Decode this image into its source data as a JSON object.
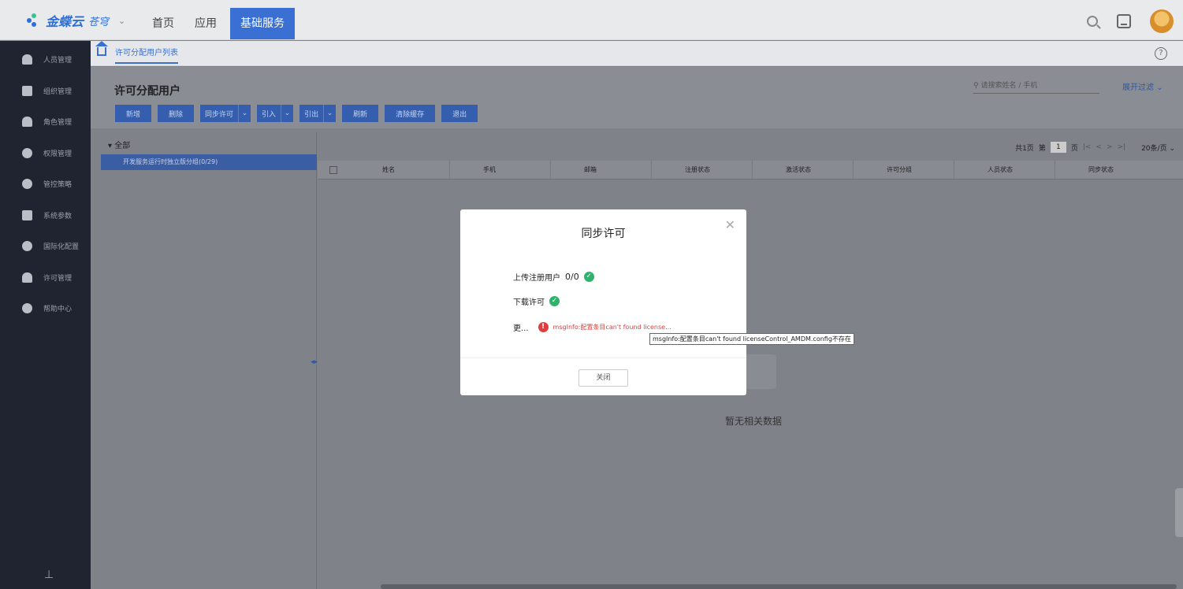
{
  "header": {
    "brand": "金蝶云",
    "brand_sub": "苍穹",
    "nav": [
      "首页",
      "应用",
      "基础服务"
    ]
  },
  "sidebar": {
    "items": [
      {
        "label": "人员管理",
        "icon": "person-icon"
      },
      {
        "label": "组织管理",
        "icon": "org-icon"
      },
      {
        "label": "角色管理",
        "icon": "role-icon"
      },
      {
        "label": "权限管理",
        "icon": "permission-icon"
      },
      {
        "label": "管控策略",
        "icon": "policy-icon"
      },
      {
        "label": "系统参数",
        "icon": "gear-icon"
      },
      {
        "label": "国际化配置",
        "icon": "globe-icon"
      },
      {
        "label": "许可管理",
        "icon": "license-icon"
      },
      {
        "label": "帮助中心",
        "icon": "help-icon"
      }
    ]
  },
  "tab": {
    "label": "许可分配用户列表"
  },
  "page": {
    "title": "许可分配用户",
    "search_placeholder": "请搜索姓名 / 手机",
    "filter_label": "展开过滤",
    "toolbar": {
      "add": "新增",
      "delete": "删除",
      "sync": "同步许可",
      "import": "引入",
      "export": "引出",
      "refresh": "刷新",
      "clear_cache": "清除缓存",
      "exit": "退出"
    }
  },
  "tree": {
    "root": "全部",
    "selected": "开发服务运行时独立版分组(0/29)"
  },
  "grid": {
    "pager": {
      "total": "共1页",
      "prefix": "第",
      "page": "1",
      "suffix": "页",
      "page_size": "20条/页"
    },
    "columns": [
      "姓名",
      "手机",
      "邮箱",
      "注册状态",
      "激活状态",
      "许可分组",
      "人员状态",
      "同步状态"
    ],
    "empty_text": "暂无相关数据"
  },
  "modal": {
    "title": "同步许可",
    "row1_label": "上传注册用户",
    "row1_value": "0/0",
    "row2_label": "下载许可",
    "row3_label": "更...",
    "row3_error": "msgInfo:配置条目can't found license...",
    "close_label": "关闭",
    "tooltip": "msgInfo:配置条目can't found licenseControl_AMDM.config不存在"
  },
  "colors": {
    "accent": "#3a6fd4",
    "success": "#2db36b",
    "error": "#e03e3e",
    "sidebar_bg": "#1f2430"
  }
}
